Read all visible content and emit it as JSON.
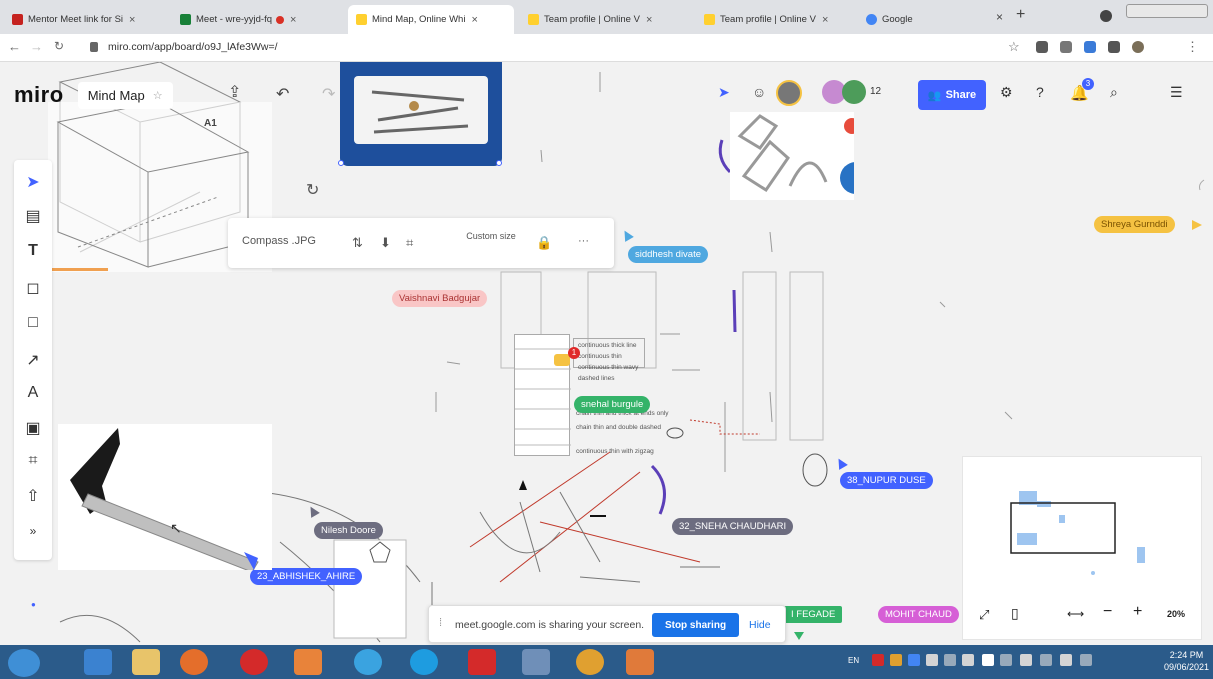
{
  "browser": {
    "tabs": [
      {
        "title": "Mentor Meet link for Si",
        "color": "#c5221f"
      },
      {
        "title": "Meet - wre-yyjd-fq",
        "color": "#188038"
      },
      {
        "title": "Mind Map, Online Whi",
        "color": "#ffd02f"
      },
      {
        "title": "Team profile | Online V",
        "color": "#ffd02f"
      },
      {
        "title": "Team profile | Online V",
        "color": "#ffd02f"
      },
      {
        "title": "Google",
        "color": "#4285f4"
      }
    ],
    "new_tab": "+",
    "url": "miro.com/app/board/o9J_lAfe3Ww=/"
  },
  "miro": {
    "logo": "miro",
    "board_name": "Mind Map",
    "collaborator_count": "12",
    "share_label": "Share",
    "notification_count": "3"
  },
  "toolbar": {
    "tools": [
      "select-tool",
      "frame-tool",
      "text-tool",
      "sticky-note-tool",
      "shape-tool",
      "connector-tool",
      "pen-tool",
      "comment-tool",
      "crop-tool",
      "upload-tool",
      "more-tools"
    ],
    "more_label": "»"
  },
  "context_bar": {
    "file_name": "Compass .JPG",
    "custom_size": "Custom size",
    "more": "···"
  },
  "canvas": {
    "frame_label": "A1",
    "doc_lines": [
      "continuous thick line",
      "continuous thin",
      "continuous thin wavy",
      "dashed lines",
      "chain thin and thick at ends only",
      "chain thin and double dashed",
      "continuous thin with zigzag"
    ]
  },
  "cursors": [
    {
      "name": "siddhesh divate",
      "color": "#4fa8e0"
    },
    {
      "name": "Vaishnavi Badgujar",
      "color": "#f5a6a6"
    },
    {
      "name": "Shreya Gurnddi",
      "color": "#f5c242"
    },
    {
      "name": "snehal burgule",
      "color": "#34b369"
    },
    {
      "name": "38_NUPUR DUSE",
      "color": "#4262ff"
    },
    {
      "name": "32_SNEHA CHAUDHARI",
      "color": "#6d6d80"
    },
    {
      "name": "Nilesh Doore",
      "color": "#6d6d80"
    },
    {
      "name": "23_ABHISHEK_AHIRE",
      "color": "#4262ff"
    },
    {
      "name": "MOHIT CHAUD",
      "color": "#d65fd6"
    },
    {
      "name": "I FEGADE",
      "color": "#34b369"
    }
  ],
  "zoom": {
    "level": "20%"
  },
  "share_banner": {
    "text": "meet.google.com is sharing your screen.",
    "stop_label": "Stop sharing",
    "hide_label": "Hide"
  },
  "taskbar": {
    "time": "2:24 PM",
    "date": "09/06/2021",
    "language": "EN"
  }
}
